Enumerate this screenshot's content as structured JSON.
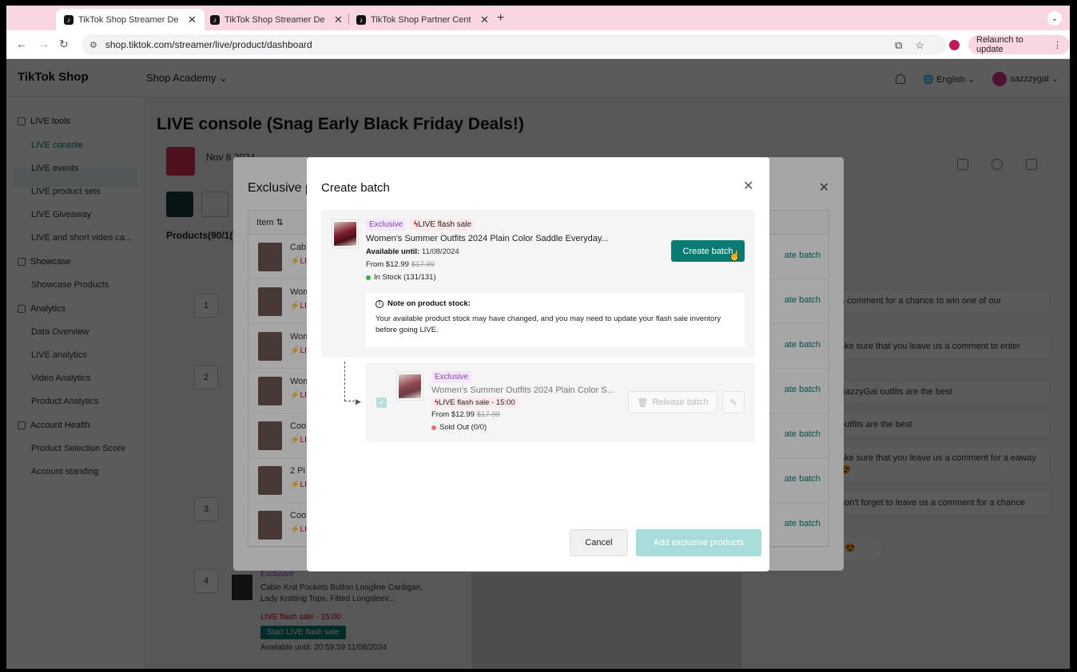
{
  "browser": {
    "tabs": [
      {
        "title": "TikTok Shop Streamer Deskto",
        "active": true
      },
      {
        "title": "TikTok Shop Streamer Deskto",
        "active": false
      },
      {
        "title": "TikTok Shop Partner Center",
        "active": false
      }
    ],
    "url": "shop.tiktok.com/streamer/live/product/dashboard",
    "relaunch_label": "Relaunch to update"
  },
  "header": {
    "logo": "TikTok Shop",
    "nav_label": "Shop Academy",
    "language": "English",
    "username": "sazzzygal"
  },
  "sidebar": {
    "groups": [
      {
        "label": "LIVE tools",
        "items": [
          "LIVE console",
          "LIVE events",
          "LIVE product sets",
          "LIVE Giveaway",
          "LIVE and short video ca..."
        ]
      },
      {
        "label": "Showcase",
        "items": [
          "Showcase Products"
        ]
      },
      {
        "label": "Analytics",
        "items": [
          "Data Overview",
          "LIVE analytics",
          "Video Analytics",
          "Product Analytics"
        ]
      },
      {
        "label": "Account Health",
        "items": [
          "Product Selection Score",
          "Account standing"
        ]
      }
    ],
    "active_item": "LIVE console"
  },
  "main": {
    "title": "LIVE console (Snag Early Black Friday Deals!)",
    "live_date": "Nov 8 2024",
    "products_label": "Products(90/1(",
    "row_numbers": [
      "1",
      "2",
      "3",
      "4"
    ],
    "bottom_card": {
      "tag": "Exclusive",
      "title": "Cable Knit Pockets Button Longline Cardigan, Lady Knitting Tops, Fitted Longsleev...",
      "flash": "LIVE flash sale - 15:00",
      "button": "Start LIVE flash sale",
      "available": "Available until: 20:59:59 11/08/2024"
    },
    "chat": [
      "a comment for a chance to win one of our",
      "ake sure that you leave us a comment to enter",
      "SazzyGal outfits are the best",
      "outfits are the best",
      "ake sure that you leave us a comment for a eaway 😍",
      "don't forget to leave us a comment for a chance",
      "t 😍"
    ]
  },
  "exclusive_modal": {
    "title": "Exclusive p",
    "column_item": "Item",
    "rows": [
      {
        "name": "Cab",
        "flash": "⚡LI",
        "action": "ate batch"
      },
      {
        "name": "Wom",
        "flash": "⚡LI",
        "action": "ate batch"
      },
      {
        "name": "Wom",
        "flash": "⚡LI",
        "action": "ate batch"
      },
      {
        "name": "Wom",
        "flash": "⚡LI",
        "action": "ate batch"
      },
      {
        "name": "Coo",
        "flash": "⚡LI",
        "action": "ate batch"
      },
      {
        "name": "2 Pi",
        "flash": "⚡LI",
        "action": "ate batch"
      },
      {
        "name": "Coo",
        "flash": "⚡LI",
        "action": "ate batch"
      }
    ]
  },
  "batch_modal": {
    "title": "Create batch",
    "original": {
      "tag_exclusive": "Exclusive",
      "tag_flash": "LIVE flash sale",
      "name": "Women's Summer Outfits 2024 Plain Color Saddle Everyday...",
      "available_label": "Available until:",
      "available_value": "11/08/2024",
      "price": "From $12.99",
      "original_price": "$17.99",
      "stock": "In Stock (131/131)",
      "create_button": "Create batch"
    },
    "note": {
      "title": "Note on product stock:",
      "body": "Your available product stock may have changed, and you may need to update your flash sale inventory before going LIVE."
    },
    "batch": {
      "tag_exclusive": "Exclusive",
      "name": "Women's Summer Outfits 2024 Plain Color S...",
      "flash": "LIVE flash sale - 15:00",
      "price": "From $12.99",
      "original_price": "$17.99",
      "stock": "Sold Out (0/0)",
      "release_button": "Release batch"
    },
    "cancel_button": "Cancel",
    "add_button": "Add exclusive products"
  },
  "colors": {
    "brand_teal": "#0a7a73",
    "flash_red": "#d0021b",
    "exclusive_purple": "#8a3fb8",
    "tab_pink": "#f8d7e2"
  }
}
